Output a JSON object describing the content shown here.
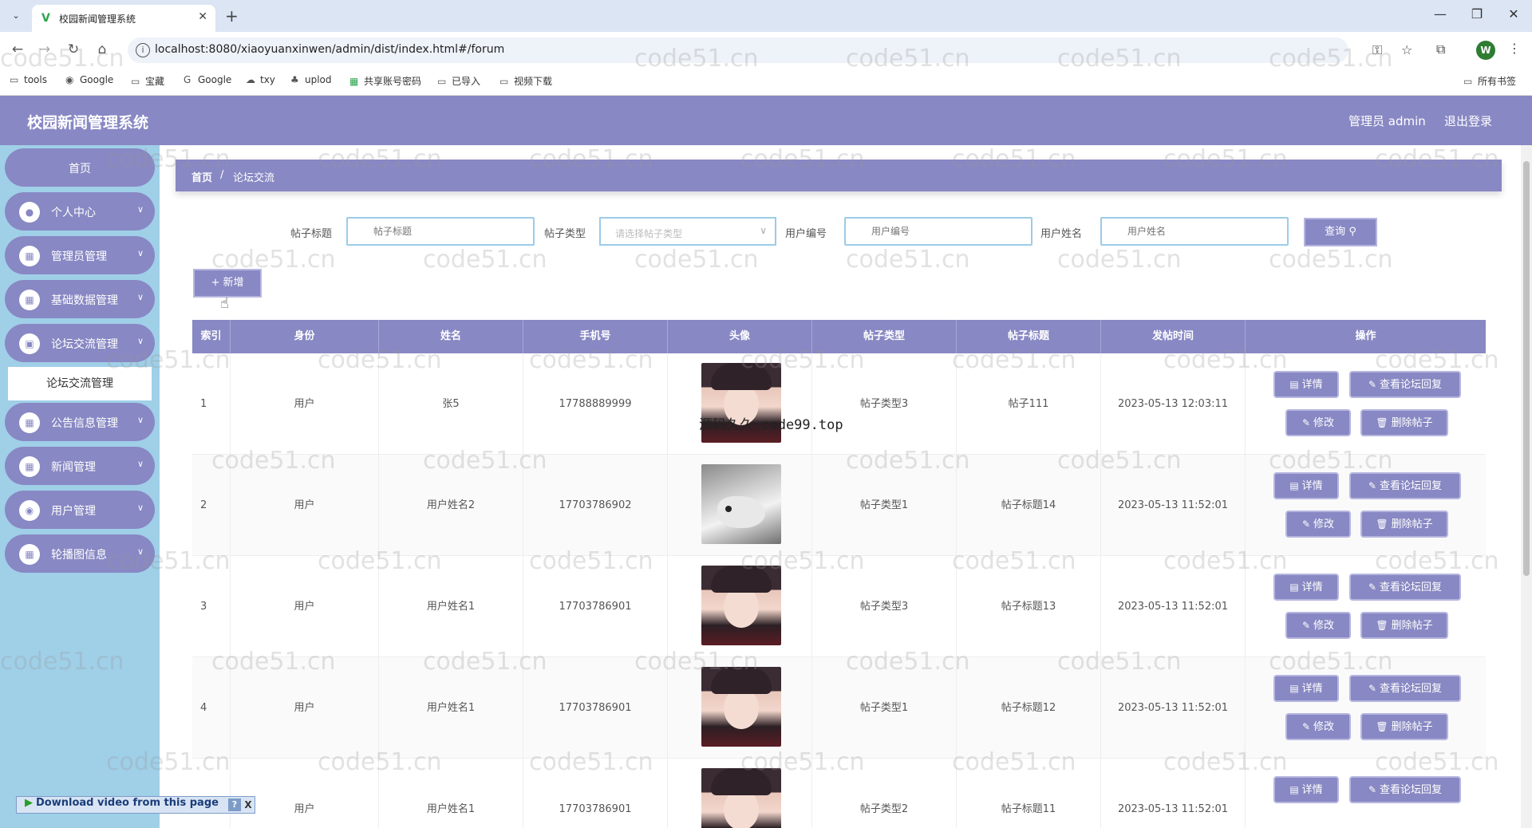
{
  "browser": {
    "tab_title": "校园新闻管理系统",
    "url": "localhost:8080/xiaoyuanxinwen/admin/dist/index.html#/forum",
    "profile_initial": "W",
    "bookmarks": [
      "tools",
      "Google",
      "宝藏",
      "Google",
      "txy",
      "uplod",
      "共享账号密码",
      "已导入",
      "视频下载"
    ],
    "all_bookmarks": "所有书签"
  },
  "header": {
    "title": "校园新闻管理系统",
    "admin_label": "管理员 admin",
    "logout": "退出登录"
  },
  "sidebar": {
    "home": "首页",
    "items": [
      {
        "label": "个人中心",
        "icon": "user-icon"
      },
      {
        "label": "管理员管理",
        "icon": "grid-icon"
      },
      {
        "label": "基础数据管理",
        "icon": "grid-icon"
      },
      {
        "label": "论坛交流管理",
        "icon": "forum-icon"
      },
      {
        "label": "公告信息管理",
        "icon": "grid-icon"
      },
      {
        "label": "新闻管理",
        "icon": "grid-icon"
      },
      {
        "label": "用户管理",
        "icon": "location-icon"
      },
      {
        "label": "轮播图信息",
        "icon": "grid-icon"
      }
    ],
    "sub_active": "论坛交流管理"
  },
  "breadcrumb": {
    "home": "首页",
    "sep": "/",
    "current": "论坛交流"
  },
  "filters": {
    "title_label": "帖子标题",
    "title_placeholder": "帖子标题",
    "type_label": "帖子类型",
    "type_placeholder": "请选择帖子类型",
    "userno_label": "用户编号",
    "userno_placeholder": "用户编号",
    "username_label": "用户姓名",
    "username_placeholder": "用户姓名",
    "query_button": "查询"
  },
  "add_button": "+ 新增",
  "table": {
    "columns": [
      "索引",
      "身份",
      "姓名",
      "手机号",
      "头像",
      "帖子类型",
      "帖子标题",
      "发帖时间",
      "操作"
    ],
    "rows": [
      {
        "idx": "1",
        "role": "用户",
        "name": "张5",
        "phone": "17788889999",
        "avatar": "girl",
        "type": "帖子类型3",
        "title": "帖子111",
        "time": "2023-05-13 12:03:11"
      },
      {
        "idx": "2",
        "role": "用户",
        "name": "用户姓名2",
        "phone": "17703786902",
        "avatar": "dog",
        "type": "帖子类型1",
        "title": "帖子标题14",
        "time": "2023-05-13 11:52:01"
      },
      {
        "idx": "3",
        "role": "用户",
        "name": "用户姓名1",
        "phone": "17703786901",
        "avatar": "girl",
        "type": "帖子类型3",
        "title": "帖子标题13",
        "time": "2023-05-13 11:52:01"
      },
      {
        "idx": "4",
        "role": "用户",
        "name": "用户姓名1",
        "phone": "17703786901",
        "avatar": "girl",
        "type": "帖子类型1",
        "title": "帖子标题12",
        "time": "2023-05-13 11:52:01"
      },
      {
        "idx": "",
        "role": "用户",
        "name": "用户姓名1",
        "phone": "17703786901",
        "avatar": "girl",
        "type": "帖子类型2",
        "title": "帖子标题11",
        "time": "2023-05-13 11:52:01"
      }
    ],
    "actions": {
      "detail": "详情",
      "view_reply": "查看论坛回复",
      "edit": "修改",
      "delete": "删除帖子"
    }
  },
  "watermark": "code51.cn",
  "watermark2": "源码久久 code99.top",
  "download_bar": {
    "label": "Download video from this page",
    "help": "?",
    "close": "X"
  },
  "colors": {
    "primary": "#8888c4",
    "sidebar_bg": "#a0cfe8",
    "input_border": "#9ccbe8"
  }
}
